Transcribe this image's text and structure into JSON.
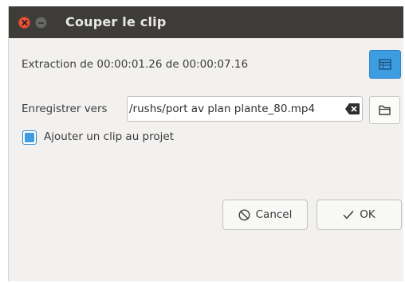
{
  "window": {
    "title": "Couper le clip"
  },
  "extraction": {
    "text": "Extraction de 00:00:01.26 de 00:00:07.16"
  },
  "save": {
    "label": "Enregistrer vers",
    "path": "/rushs/port av plan plante_80.mp4"
  },
  "add_clip": {
    "label": "Ajouter un clip au projet",
    "checked": true
  },
  "buttons": {
    "cancel": "Cancel",
    "ok": "OK"
  },
  "icons": {
    "window_close": "close-icon",
    "window_minimize": "minimize-icon",
    "extraction_options": "table-icon",
    "clear_path": "backspace-clear-icon",
    "browse": "folder-icon",
    "cancel": "cancel-circle-icon",
    "ok": "checkmark-icon"
  },
  "colors": {
    "titlebar": "#3d3c38",
    "accent": "#3d9de0",
    "close": "#e9563b"
  }
}
